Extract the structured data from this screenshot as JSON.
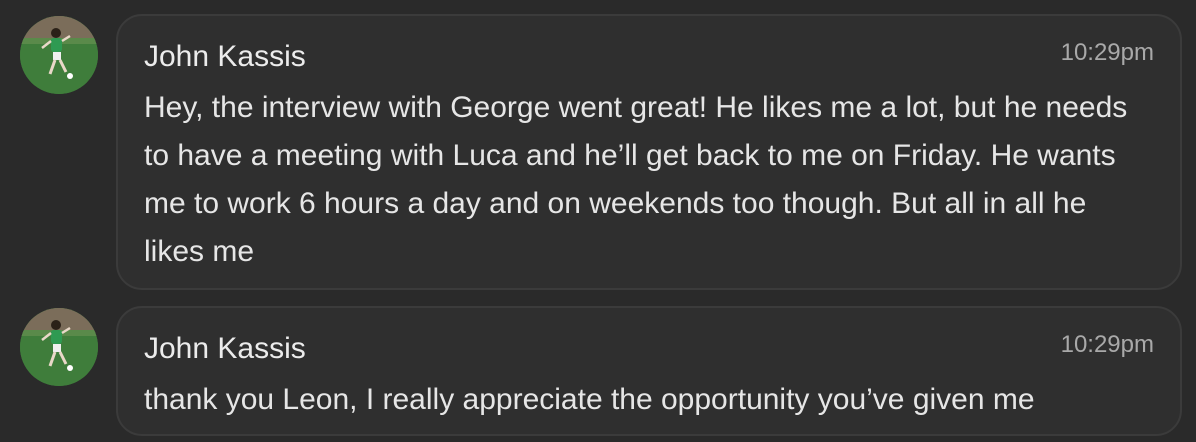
{
  "messages": [
    {
      "sender": "John Kassis",
      "time": "10:29pm",
      "avatar_icon": "user-avatar-photo",
      "text": "Hey, the interview with George went great! He likes me a lot, but he needs to have a meeting with Luca and he’ll get back to me on Friday. He wants me to work 6 hours a day and on weekends too though. But all in all he likes me"
    },
    {
      "sender": "John Kassis",
      "time": "10:29pm",
      "avatar_icon": "user-avatar-photo",
      "text": "thank you Leon, I really appreciate the opportunity you’ve given me"
    }
  ],
  "colors": {
    "background": "#2a2a2a",
    "bubble": "#2f2f2f",
    "bubble_border": "#3b3b3b",
    "text": "#e6e6e6",
    "timestamp": "#a9a9a9"
  }
}
